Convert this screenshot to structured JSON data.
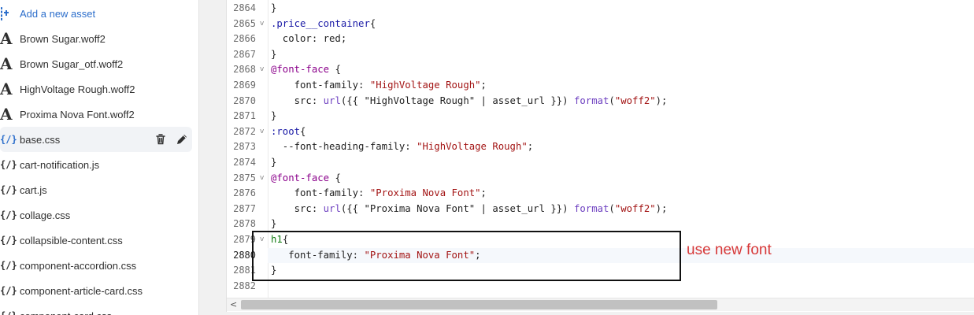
{
  "sidebar": {
    "add_asset_label": "Add a new asset",
    "files": [
      {
        "name": "Brown Sugar.woff2",
        "type": "font"
      },
      {
        "name": "Brown Sugar_otf.woff2",
        "type": "font"
      },
      {
        "name": "HighVoltage Rough.woff2",
        "type": "font"
      },
      {
        "name": "Proxima Nova Font.woff2",
        "type": "font"
      },
      {
        "name": "base.css",
        "type": "code",
        "selected": true
      },
      {
        "name": "cart-notification.js",
        "type": "code"
      },
      {
        "name": "cart.js",
        "type": "code"
      },
      {
        "name": "collage.css",
        "type": "code"
      },
      {
        "name": "collapsible-content.css",
        "type": "code"
      },
      {
        "name": "component-accordion.css",
        "type": "code"
      },
      {
        "name": "component-article-card.css",
        "type": "code"
      },
      {
        "name": "component-card.css",
        "type": "code"
      }
    ],
    "font_glyph": "A",
    "code_glyph": "{/}"
  },
  "editor": {
    "lines": [
      {
        "n": "2864",
        "fold": false,
        "tokens": [
          [
            "punc",
            "}"
          ]
        ]
      },
      {
        "n": "2865",
        "fold": true,
        "tokens": [
          [
            "sel",
            ".price__container"
          ],
          [
            "punc",
            "{"
          ]
        ]
      },
      {
        "n": "2866",
        "fold": false,
        "tokens": [
          [
            "prop",
            "  color: red;"
          ]
        ]
      },
      {
        "n": "2867",
        "fold": false,
        "tokens": [
          [
            "punc",
            "}"
          ]
        ]
      },
      {
        "n": "2868",
        "fold": true,
        "tokens": [
          [
            "at",
            "@font-face"
          ],
          [
            "punc",
            " {"
          ]
        ]
      },
      {
        "n": "2869",
        "fold": false,
        "tokens": [
          [
            "prop",
            "    font-family: "
          ],
          [
            "str",
            "\"HighVoltage Rough\""
          ],
          [
            "punc",
            ";"
          ]
        ]
      },
      {
        "n": "2870",
        "fold": false,
        "tokens": [
          [
            "prop",
            "    src: "
          ],
          [
            "fn",
            "url"
          ],
          [
            "punc",
            "({{ \"HighVoltage Rough\" | asset_url }}) "
          ],
          [
            "fn",
            "format"
          ],
          [
            "punc",
            "("
          ],
          [
            "str",
            "\"woff2\""
          ],
          [
            "punc",
            ");"
          ]
        ]
      },
      {
        "n": "2871",
        "fold": false,
        "tokens": [
          [
            "punc",
            "}"
          ]
        ]
      },
      {
        "n": "2872",
        "fold": true,
        "tokens": [
          [
            "sel",
            ":root"
          ],
          [
            "punc",
            "{"
          ]
        ]
      },
      {
        "n": "2873",
        "fold": false,
        "tokens": [
          [
            "prop",
            "  --font-heading-family: "
          ],
          [
            "str",
            "\"HighVoltage Rough\""
          ],
          [
            "punc",
            ";"
          ]
        ]
      },
      {
        "n": "2874",
        "fold": false,
        "tokens": [
          [
            "punc",
            "}"
          ]
        ]
      },
      {
        "n": "2875",
        "fold": true,
        "tokens": [
          [
            "at",
            "@font-face"
          ],
          [
            "punc",
            " {"
          ]
        ]
      },
      {
        "n": "2876",
        "fold": false,
        "tokens": [
          [
            "prop",
            "    font-family: "
          ],
          [
            "str",
            "\"Proxima Nova Font\""
          ],
          [
            "punc",
            ";"
          ]
        ]
      },
      {
        "n": "2877",
        "fold": false,
        "tokens": [
          [
            "prop",
            "    src: "
          ],
          [
            "fn",
            "url"
          ],
          [
            "punc",
            "({{ \"Proxima Nova Font\" | asset_url }}) "
          ],
          [
            "fn",
            "format"
          ],
          [
            "punc",
            "("
          ],
          [
            "str",
            "\"woff2\""
          ],
          [
            "punc",
            ");"
          ]
        ]
      },
      {
        "n": "2878",
        "fold": false,
        "tokens": [
          [
            "punc",
            "}"
          ]
        ]
      },
      {
        "n": "2879",
        "fold": true,
        "tokens": [
          [
            "h1",
            "h1"
          ],
          [
            "punc",
            "{"
          ]
        ]
      },
      {
        "n": "2880",
        "fold": false,
        "current": true,
        "tokens": [
          [
            "prop",
            "   font-family: "
          ],
          [
            "str",
            "\"Proxima Nova Font\""
          ],
          [
            "punc",
            ";"
          ]
        ]
      },
      {
        "n": "2881",
        "fold": false,
        "tokens": [
          [
            "punc",
            "}"
          ]
        ]
      },
      {
        "n": "2882",
        "fold": false,
        "tokens": []
      }
    ],
    "fold_glyph": "v",
    "scroll_left_glyph": "<"
  },
  "annotation": {
    "text": "use new font",
    "color": "#d73838"
  },
  "colors": {
    "accent": "#2c6ecb",
    "string": "#a31515",
    "selector": "#1a1aa6",
    "at_rule": "#8b008b"
  }
}
